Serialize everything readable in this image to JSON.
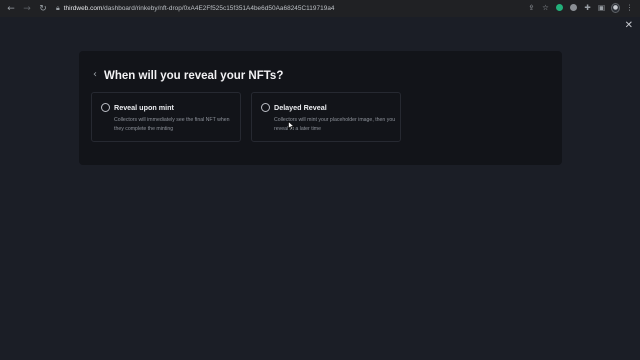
{
  "browser": {
    "url_host": "thirdweb.com",
    "url_path": "/dashboard/rinkeby/nft-drop/0xA4E2Ff525c15f351A4be6d50Aa68245C119719a4",
    "icons": [
      "back-arrow-icon",
      "forward-arrow-icon",
      "reload-icon",
      "lock-icon",
      "share-icon",
      "star-icon",
      "extension-green-icon",
      "extension-grey-icon",
      "puzzle-icon",
      "sidebar-icon",
      "profile-icon",
      "menu-icon"
    ]
  },
  "modal": {
    "title": "When will you reveal your NFTs?",
    "options": [
      {
        "title": "Reveal upon mint",
        "description": "Collectors will immediately see the final NFT when they complete the minting"
      },
      {
        "title": "Delayed Reveal",
        "description": "Collectors will mint your placeholder image, then you reveal at a later time"
      }
    ]
  },
  "colors": {
    "page_bg": "#1b1e26",
    "modal_bg": "#121419",
    "option_border": "#262931",
    "text_primary": "#f2f2f4",
    "text_secondary": "#8e939b"
  }
}
